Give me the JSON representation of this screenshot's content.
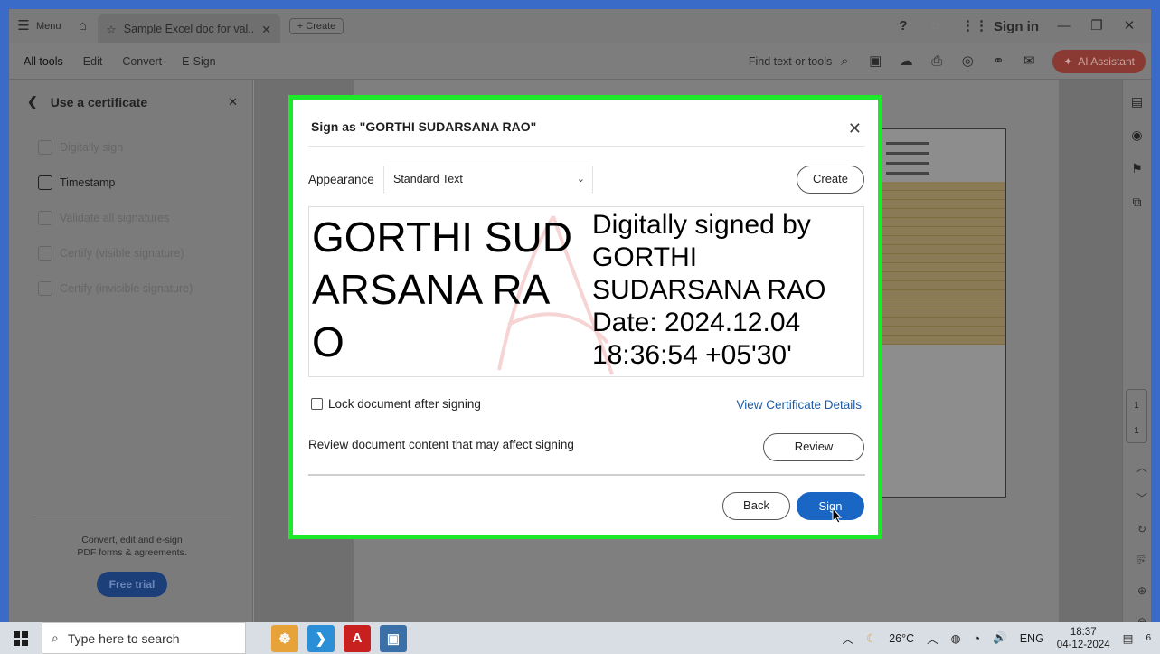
{
  "titlebar": {
    "menu_label": "Menu",
    "tab_title": "Sample Excel doc for val..",
    "create_label": "Create",
    "sign_in": "Sign in"
  },
  "toolbar": {
    "items": [
      "All tools",
      "Edit",
      "Convert",
      "E-Sign"
    ],
    "find_label": "Find text or tools",
    "ai_label": "AI Assistant"
  },
  "left_panel": {
    "title": "Use a certificate",
    "items": [
      {
        "label": "Digitally sign",
        "active": false
      },
      {
        "label": "Timestamp",
        "active": true
      },
      {
        "label": "Validate all signatures",
        "active": false
      },
      {
        "label": "Certify (visible signature)",
        "active": false
      },
      {
        "label": "Certify (invisible signature)",
        "active": false
      }
    ],
    "footer_text_1": "Convert, edit and e-sign",
    "footer_text_2": "PDF forms & agreements.",
    "free_trial": "Free trial"
  },
  "right_rail": {
    "page_current": "1",
    "page_total": "1"
  },
  "dialog": {
    "title": "Sign as \"GORTHI SUDARSANA RAO\"",
    "appearance_label": "Appearance",
    "appearance_value": "Standard Text",
    "create_button": "Create",
    "preview_name": "GORTHI SUDARSANA RAO",
    "preview_line1": "Digitally signed by",
    "preview_line2": "GORTHI",
    "preview_line3": "SUDARSANA RAO",
    "preview_line4": "Date: 2024.12.04",
    "preview_line5": "18:36:54 +05'30'",
    "lock_label": "Lock document after signing",
    "view_cert": "View Certificate Details",
    "review_text": "Review document content that may affect signing",
    "review_button": "Review",
    "back_button": "Back",
    "sign_button": "Sign"
  },
  "taskbar": {
    "search_placeholder": "Type here to search",
    "temperature": "26°C",
    "language": "ENG",
    "time": "18:37",
    "date": "04-12-2024",
    "notification_count": "6"
  },
  "colors": {
    "frame_blue": "#3b6bc9",
    "highlight_green": "#1ee82a",
    "sign_blue": "#1a66c5",
    "link_blue": "#1a5aa6"
  }
}
